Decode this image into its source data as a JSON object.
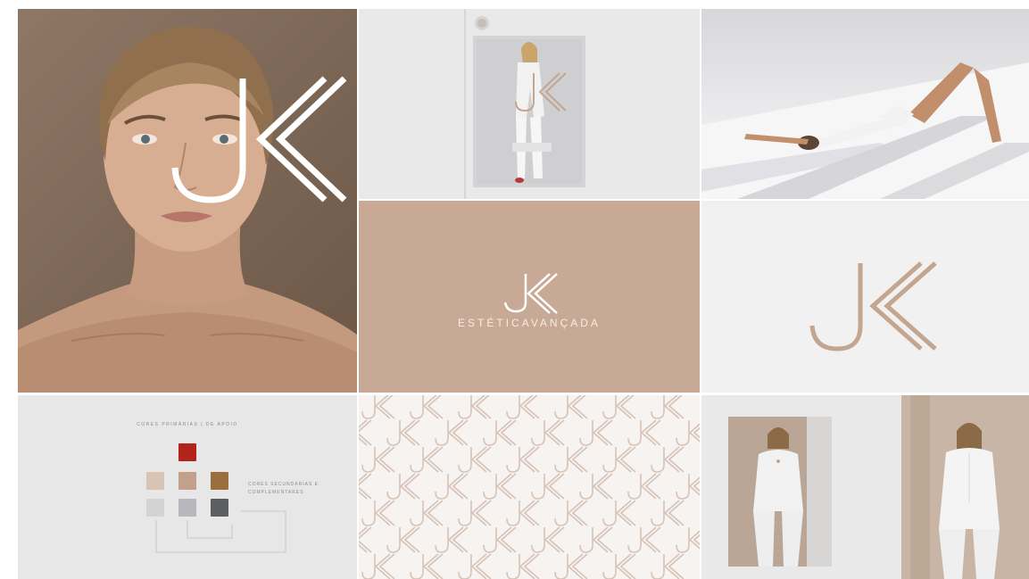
{
  "brand": {
    "monogram": "JK",
    "tagline": "ESTÉTICAVANÇADA",
    "colors": {
      "primary_beige": "#c8a995",
      "white": "#ffffff",
      "mark_brown": "#c4a58f"
    }
  },
  "palette": {
    "title": "CORES PRIMÁRIAS | DE APOIO",
    "note": "CORES SECUNDÁRIAS E COMPLEMENTARES",
    "swatches": [
      {
        "name": "red",
        "color": "#b1231b"
      },
      {
        "name": "light-beige",
        "color": "#d9c3b3"
      },
      {
        "name": "mid-beige",
        "color": "#c3a08c"
      },
      {
        "name": "caramel",
        "color": "#9a6e3d"
      },
      {
        "name": "light-gray",
        "color": "#d2d3d5"
      },
      {
        "name": "mid-gray",
        "color": "#b6b8bb"
      },
      {
        "name": "dark-gray",
        "color": "#5c5e61"
      }
    ]
  }
}
